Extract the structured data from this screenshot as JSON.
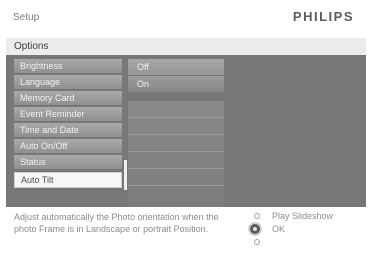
{
  "header": {
    "title": "Setup",
    "brand": "PHILIPS"
  },
  "section": {
    "title": "Options"
  },
  "menu": {
    "items": [
      {
        "label": "Brightness"
      },
      {
        "label": "Language"
      },
      {
        "label": "Memory Card"
      },
      {
        "label": "Event Reminder"
      },
      {
        "label": "Time and Date"
      },
      {
        "label": "Auto On/Off"
      },
      {
        "label": "Status"
      }
    ],
    "selected": {
      "label": "Auto Tilt"
    }
  },
  "values": {
    "items": [
      {
        "label": "Off"
      },
      {
        "label": "On"
      }
    ]
  },
  "footer": {
    "help_text": "Adjust automatically the Photo orientation when the photo Frame is in Landscape or portrait Position.",
    "legend": {
      "play": "Play Slideshow",
      "ok": "OK"
    }
  }
}
